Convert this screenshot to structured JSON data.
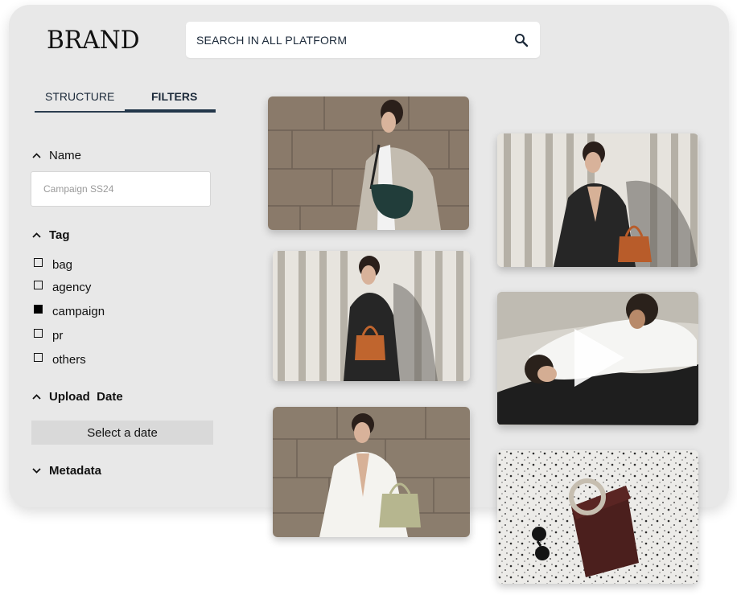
{
  "brand": "BRAND",
  "search": {
    "placeholder": "SEARCH IN ALL PLATFORM"
  },
  "tabs": [
    {
      "label": "STRUCTURE",
      "active": false
    },
    {
      "label": "FILTERS",
      "active": true
    }
  ],
  "filters": {
    "name": {
      "heading": "Name",
      "placeholder": "Campaign SS24"
    },
    "tag": {
      "heading": "Tag",
      "options": [
        {
          "label": "bag",
          "checked": false
        },
        {
          "label": "agency",
          "checked": false
        },
        {
          "label": "campaign",
          "checked": true
        },
        {
          "label": "pr",
          "checked": false
        },
        {
          "label": "others",
          "checked": false
        }
      ]
    },
    "upload_date": {
      "heading": "Upload  Date",
      "button": "Select a date"
    },
    "metadata": {
      "heading": "Metadata"
    }
  },
  "gallery": [
    {
      "name": "photo-woman-grey-blazer-green-bag"
    },
    {
      "name": "photo-woman-black-suit-orange-bag-stripes"
    },
    {
      "name": "photo-woman-black-coat-orange-bag"
    },
    {
      "name": "video-two-women-lying-white"
    },
    {
      "name": "photo-woman-white-suit-sage-bag"
    },
    {
      "name": "photo-brown-bag-sunglasses-terrazzo"
    }
  ]
}
